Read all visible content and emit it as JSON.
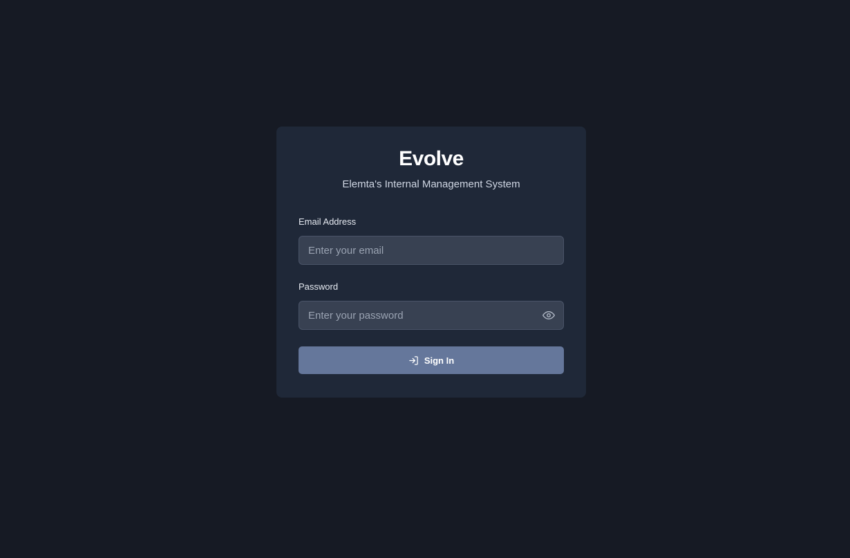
{
  "app": {
    "title": "Evolve",
    "subtitle": "Elemta's Internal Management System"
  },
  "form": {
    "email": {
      "label": "Email Address",
      "placeholder": "Enter your email",
      "value": ""
    },
    "password": {
      "label": "Password",
      "placeholder": "Enter your password",
      "value": "",
      "toggle_icon": "eye-icon"
    },
    "submit": {
      "label": "Sign In",
      "icon": "log-in-icon"
    }
  },
  "colors": {
    "page_background": "#161a24",
    "card_background": "#1f2838",
    "input_background": "#384152",
    "input_border": "#4a5468",
    "button_background": "#65779b",
    "title_text": "#ffffff",
    "placeholder_text": "#9aa3b2"
  }
}
